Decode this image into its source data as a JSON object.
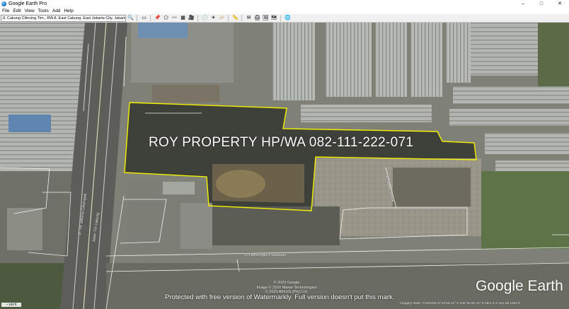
{
  "window": {
    "title": "Google Earth Pro",
    "controls": {
      "minimize": "–",
      "maximize": "□",
      "close": "✕"
    }
  },
  "menu": [
    "File",
    "Edit",
    "View",
    "Tools",
    "Add",
    "Help"
  ],
  "toolbar": {
    "search_value": "Jl. Cakung Cilincing Tim., RW.8, East Cakung, East Jakarta City, Jakarta",
    "buttons": [
      {
        "name": "search-icon",
        "glyph": "🔍"
      },
      {
        "name": "sidebar-icon",
        "glyph": "▭"
      },
      {
        "name": "add-placemark-icon",
        "glyph": "📌"
      },
      {
        "name": "add-polygon-icon",
        "glyph": "⬠"
      },
      {
        "name": "add-path-icon",
        "glyph": "〰"
      },
      {
        "name": "add-overlay-icon",
        "glyph": "▦"
      },
      {
        "name": "record-tour-icon",
        "glyph": "🎥"
      },
      {
        "name": "historical-imagery-icon",
        "glyph": "🕘"
      },
      {
        "name": "sunlight-icon",
        "glyph": "☀"
      },
      {
        "name": "planets-icon",
        "glyph": "🪐"
      },
      {
        "name": "ruler-icon",
        "glyph": "📏"
      },
      {
        "name": "email-icon",
        "glyph": "✉"
      },
      {
        "name": "print-icon",
        "glyph": "🖨"
      },
      {
        "name": "save-image-icon",
        "glyph": "🖼"
      },
      {
        "name": "maps-icon",
        "glyph": "🗺"
      },
      {
        "name": "earth-icon",
        "glyph": "🌐"
      }
    ]
  },
  "map": {
    "banner": "ROY PROPERTY HP/WA 082-111-222-071",
    "road_labels": [
      "Jl. Tol Jakarta Cikampek",
      "Jalan Tol Cakung",
      "Jl. Rawa Teratai",
      "Jl. Hamengku Pahlawan"
    ],
    "copyright": [
      "© 2020 Google",
      "Image © 2020 Maxar Technologies",
      "© 2020 AfriGIS (Pty) Ltd."
    ],
    "protect_notice": "Protected with free version of Watermarkly. Full version doesn't put this mark.",
    "logo": "Google Earth",
    "status": "Imagery Date: 7/15/2020   6°10'53.13\" S  106°56'40.42\" E   elev 3 m   eye alt 1094 ft",
    "scale": "~ 100 ft"
  },
  "colors": {
    "boundary": "#f4f000",
    "roads": "#ffffff",
    "toolbar_bg": "#f0f0f0"
  }
}
